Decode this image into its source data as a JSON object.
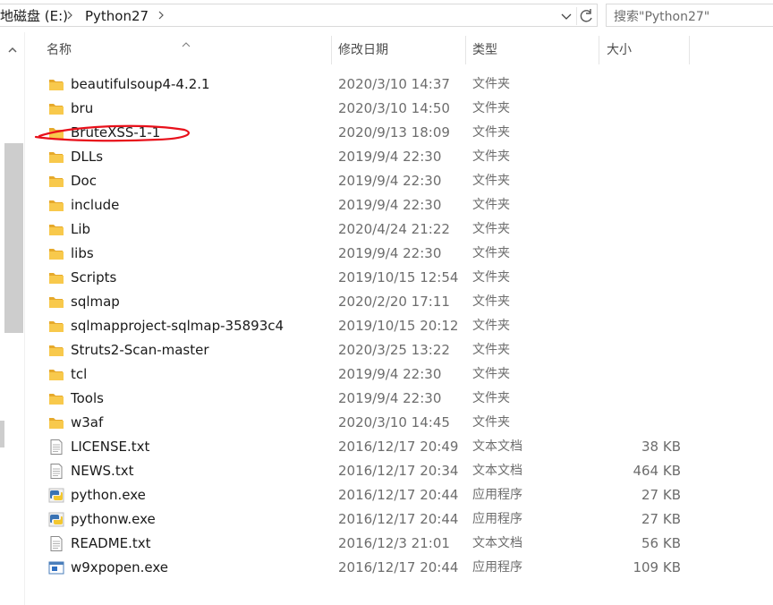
{
  "address": {
    "crumbs": [
      "地磁盘 (E:)",
      "Python27"
    ],
    "search_placeholder": "搜索\"Python27\""
  },
  "columns": {
    "name": "名称",
    "date": "修改日期",
    "type": "类型",
    "size": "大小"
  },
  "files": [
    {
      "name": "beautifulsoup4-4.2.1",
      "date": "2020/3/10 14:37",
      "type": "文件夹",
      "size": "",
      "icon": "folder"
    },
    {
      "name": "bru",
      "date": "2020/3/10 14:50",
      "type": "文件夹",
      "size": "",
      "icon": "folder"
    },
    {
      "name": "BruteXSS-1-1",
      "date": "2020/9/13 18:09",
      "type": "文件夹",
      "size": "",
      "icon": "folder"
    },
    {
      "name": "DLLs",
      "date": "2019/9/4 22:30",
      "type": "文件夹",
      "size": "",
      "icon": "folder"
    },
    {
      "name": "Doc",
      "date": "2019/9/4 22:30",
      "type": "文件夹",
      "size": "",
      "icon": "folder"
    },
    {
      "name": "include",
      "date": "2019/9/4 22:30",
      "type": "文件夹",
      "size": "",
      "icon": "folder"
    },
    {
      "name": "Lib",
      "date": "2020/4/24 21:22",
      "type": "文件夹",
      "size": "",
      "icon": "folder"
    },
    {
      "name": "libs",
      "date": "2019/9/4 22:30",
      "type": "文件夹",
      "size": "",
      "icon": "folder"
    },
    {
      "name": "Scripts",
      "date": "2019/10/15 12:54",
      "type": "文件夹",
      "size": "",
      "icon": "folder"
    },
    {
      "name": "sqlmap",
      "date": "2020/2/20 17:11",
      "type": "文件夹",
      "size": "",
      "icon": "folder"
    },
    {
      "name": "sqlmapproject-sqlmap-35893c4",
      "date": "2019/10/15 20:12",
      "type": "文件夹",
      "size": "",
      "icon": "folder"
    },
    {
      "name": "Struts2-Scan-master",
      "date": "2020/3/25 13:22",
      "type": "文件夹",
      "size": "",
      "icon": "folder"
    },
    {
      "name": "tcl",
      "date": "2019/9/4 22:30",
      "type": "文件夹",
      "size": "",
      "icon": "folder"
    },
    {
      "name": "Tools",
      "date": "2019/9/4 22:30",
      "type": "文件夹",
      "size": "",
      "icon": "folder"
    },
    {
      "name": "w3af",
      "date": "2020/3/10 14:45",
      "type": "文件夹",
      "size": "",
      "icon": "folder"
    },
    {
      "name": "LICENSE.txt",
      "date": "2016/12/17 20:49",
      "type": "文本文档",
      "size": "38 KB",
      "icon": "text"
    },
    {
      "name": "NEWS.txt",
      "date": "2016/12/17 20:34",
      "type": "文本文档",
      "size": "464 KB",
      "icon": "text"
    },
    {
      "name": "python.exe",
      "date": "2016/12/17 20:44",
      "type": "应用程序",
      "size": "27 KB",
      "icon": "python"
    },
    {
      "name": "pythonw.exe",
      "date": "2016/12/17 20:44",
      "type": "应用程序",
      "size": "27 KB",
      "icon": "python"
    },
    {
      "name": "README.txt",
      "date": "2016/12/3 21:01",
      "type": "文本文档",
      "size": "56 KB",
      "icon": "text"
    },
    {
      "name": "w9xpopen.exe",
      "date": "2016/12/17 20:44",
      "type": "应用程序",
      "size": "109 KB",
      "icon": "exe"
    }
  ],
  "colors": {
    "folder": "#f8c94c",
    "folder_dark": "#e6a92b",
    "annotation": "#e8101a"
  }
}
